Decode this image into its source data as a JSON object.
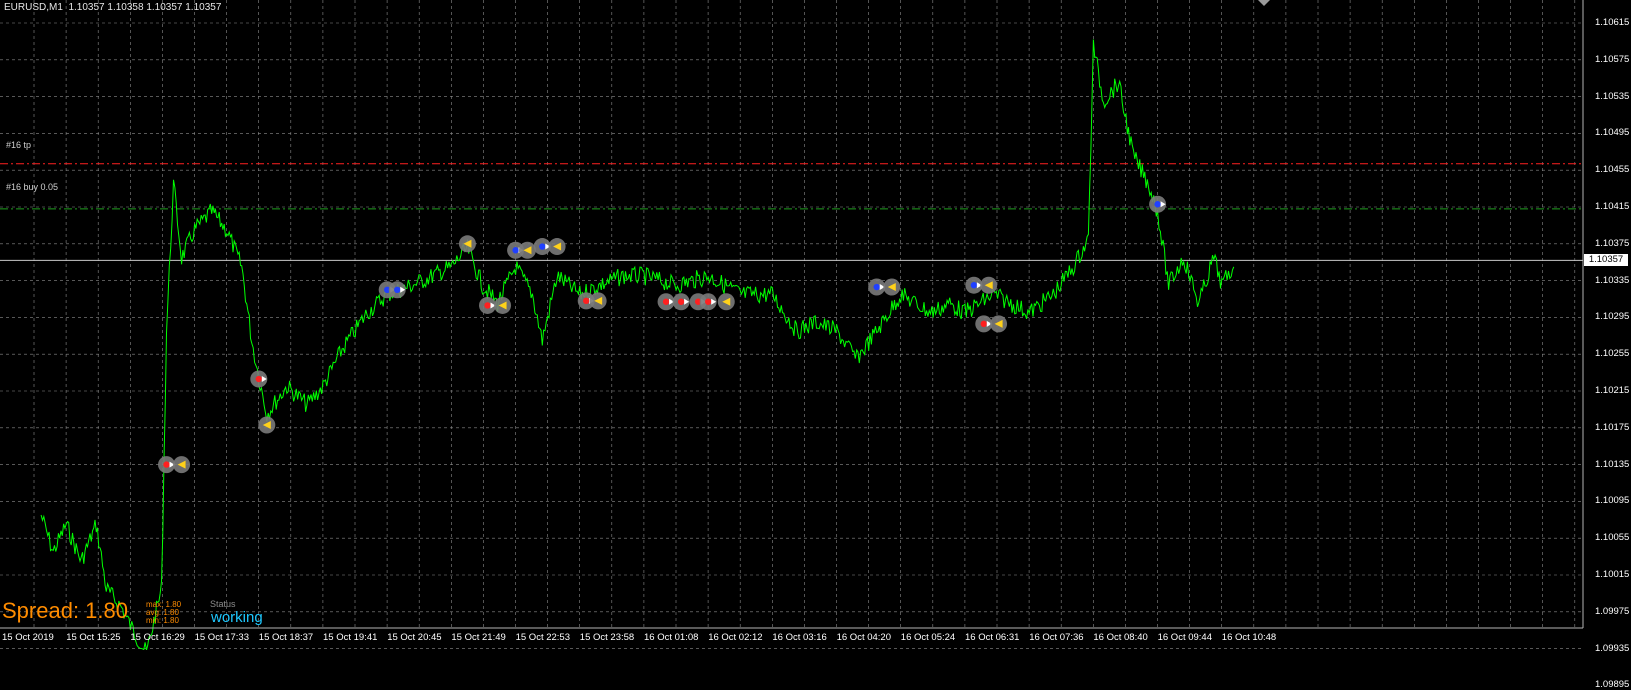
{
  "header": {
    "symbol": "EURUSD,M1",
    "quotes": "1.10357 1.10358 1.10357 1.10357"
  },
  "levels": {
    "tp_label": "#16 tp",
    "buy_label": "#16 buy 0.05",
    "current_price": "1.10357"
  },
  "price_axis": [
    "1.10615",
    "1.10575",
    "1.10535",
    "1.10495",
    "1.10455",
    "1.10415",
    "1.10375",
    "1.10335",
    "1.10295",
    "1.10255",
    "1.10215",
    "1.10175",
    "1.10135",
    "1.10095",
    "1.10055",
    "1.10015",
    "1.09975",
    "1.09935",
    "1.09895"
  ],
  "time_axis": [
    "15 Oct 2019",
    "15 Oct 15:25",
    "15 Oct 16:29",
    "15 Oct 17:33",
    "15 Oct 18:37",
    "15 Oct 19:41",
    "15 Oct 20:45",
    "15 Oct 21:49",
    "15 Oct 22:53",
    "15 Oct 23:58",
    "16 Oct 01:08",
    "16 Oct 02:12",
    "16 Oct 03:16",
    "16 Oct 04:20",
    "16 Oct 05:24",
    "16 Oct 06:31",
    "16 Oct 07:36",
    "16 Oct 08:40",
    "16 Oct 09:44",
    "16 Oct 10:48"
  ],
  "spread_panel": {
    "spread_text": "Spread: 1.80",
    "max_text": "max: 1.80",
    "avg_text": "avg: 1.80",
    "min_text": "min: 1.80",
    "status_label": "Status",
    "status_value": "working"
  },
  "colors": {
    "background": "#000000",
    "grid": "#8c8c8c",
    "price_line": "#00ff00",
    "tp_line": "#ff2020",
    "buy_line": "#1fa01f",
    "spread_text": "#ff8c00",
    "status_value": "#1ec8ff"
  },
  "chart_data": {
    "type": "line",
    "series": [
      {
        "points": [
          [
            "15 Oct 15:00",
            1.1008
          ],
          [
            "15 Oct 15:12",
            1.1004
          ],
          [
            "15 Oct 15:25",
            1.1007
          ],
          [
            "15 Oct 15:40",
            1.1003
          ],
          [
            "15 Oct 15:55",
            1.1007
          ],
          [
            "15 Oct 16:05",
            1.1
          ],
          [
            "15 Oct 16:20",
            1.0998
          ],
          [
            "15 Oct 16:29",
            1.0996
          ],
          [
            "15 Oct 16:45",
            1.0993
          ],
          [
            "15 Oct 17:00",
            1.1
          ],
          [
            "15 Oct 17:05",
            1.1028
          ],
          [
            "15 Oct 17:12",
            1.1044
          ],
          [
            "15 Oct 17:20",
            1.1036
          ],
          [
            "15 Oct 17:33",
            1.1039
          ],
          [
            "15 Oct 17:50",
            1.1041
          ],
          [
            "15 Oct 18:05",
            1.1039
          ],
          [
            "15 Oct 18:20",
            1.1035
          ],
          [
            "15 Oct 18:30",
            1.1027
          ],
          [
            "15 Oct 18:37",
            1.1023
          ],
          [
            "15 Oct 18:45",
            1.1019
          ],
          [
            "15 Oct 19:05",
            1.1022
          ],
          [
            "15 Oct 19:25",
            1.102
          ],
          [
            "15 Oct 19:41",
            1.1022
          ],
          [
            "15 Oct 20:00",
            1.1026
          ],
          [
            "15 Oct 20:25",
            1.103
          ],
          [
            "15 Oct 20:45",
            1.1032
          ],
          [
            "15 Oct 21:10",
            1.1033
          ],
          [
            "15 Oct 21:30",
            1.1034
          ],
          [
            "15 Oct 21:49",
            1.1035
          ],
          [
            "15 Oct 22:05",
            1.1037
          ],
          [
            "15 Oct 22:20",
            1.1033
          ],
          [
            "15 Oct 22:35",
            1.1031
          ],
          [
            "15 Oct 22:53",
            1.1035
          ],
          [
            "15 Oct 23:10",
            1.1032
          ],
          [
            "15 Oct 23:20",
            1.1027
          ],
          [
            "15 Oct 23:35",
            1.1034
          ],
          [
            "15 Oct 23:58",
            1.1032
          ],
          [
            "16 Oct 00:20",
            1.1033
          ],
          [
            "16 Oct 00:45",
            1.1034
          ],
          [
            "16 Oct 01:08",
            1.1034
          ],
          [
            "16 Oct 01:40",
            1.1033
          ],
          [
            "16 Oct 02:12",
            1.1034
          ],
          [
            "16 Oct 02:45",
            1.1032
          ],
          [
            "16 Oct 03:16",
            1.1032
          ],
          [
            "16 Oct 03:40",
            1.1028
          ],
          [
            "16 Oct 04:00",
            1.1029
          ],
          [
            "16 Oct 04:20",
            1.1028
          ],
          [
            "16 Oct 04:40",
            1.1025
          ],
          [
            "16 Oct 05:00",
            1.1028
          ],
          [
            "16 Oct 05:24",
            1.1032
          ],
          [
            "16 Oct 05:55",
            1.103
          ],
          [
            "16 Oct 06:15",
            1.1031
          ],
          [
            "16 Oct 06:31",
            1.103
          ],
          [
            "16 Oct 07:00",
            1.1032
          ],
          [
            "16 Oct 07:36",
            1.103
          ],
          [
            "16 Oct 08:00",
            1.1032
          ],
          [
            "16 Oct 08:20",
            1.1035
          ],
          [
            "16 Oct 08:35",
            1.1038
          ],
          [
            "16 Oct 08:40",
            1.1059
          ],
          [
            "16 Oct 08:50",
            1.1053
          ],
          [
            "16 Oct 09:05",
            1.1055
          ],
          [
            "16 Oct 09:20",
            1.1047
          ],
          [
            "16 Oct 09:35",
            1.1044
          ],
          [
            "16 Oct 09:44",
            1.1041
          ],
          [
            "16 Oct 09:55",
            1.1033
          ],
          [
            "16 Oct 10:10",
            1.1036
          ],
          [
            "16 Oct 10:25",
            1.1031
          ],
          [
            "16 Oct 10:40",
            1.1036
          ],
          [
            "16 Oct 10:48",
            1.1033
          ],
          [
            "16 Oct 11:00",
            1.1035
          ]
        ]
      }
    ],
    "ylim": [
      1.09875,
      1.10635
    ],
    "horizontal_levels": [
      {
        "label": "#16 tp",
        "value": 1.10462,
        "color": "#ff2020",
        "style": "dash-dot"
      },
      {
        "label": "#16 buy 0.05",
        "value": 1.10413,
        "color": "#1fa01f",
        "style": "dash-dot"
      },
      {
        "label": "bid",
        "value": 1.10357,
        "color": "#c8c8c8",
        "style": "solid"
      }
    ],
    "trade_markers": [
      {
        "time": "15 Oct 17:05",
        "price": 1.10135,
        "kind": "entry-sell"
      },
      {
        "time": "15 Oct 17:20",
        "price": 1.10135,
        "kind": "exit"
      },
      {
        "time": "15 Oct 18:37",
        "price": 1.10228,
        "kind": "entry-sell"
      },
      {
        "time": "15 Oct 18:45",
        "price": 1.10178,
        "kind": "exit"
      },
      {
        "time": "15 Oct 20:45",
        "price": 1.10325,
        "kind": "entry-buy"
      },
      {
        "time": "15 Oct 20:55",
        "price": 1.10325,
        "kind": "entry-buy"
      },
      {
        "time": "15 Oct 22:05",
        "price": 1.10375,
        "kind": "exit"
      },
      {
        "time": "15 Oct 22:25",
        "price": 1.10308,
        "kind": "entry-sell"
      },
      {
        "time": "15 Oct 22:40",
        "price": 1.10308,
        "kind": "exit"
      },
      {
        "time": "15 Oct 22:53",
        "price": 1.10368,
        "kind": "entry-buy"
      },
      {
        "time": "15 Oct 23:05",
        "price": 1.10368,
        "kind": "exit"
      },
      {
        "time": "15 Oct 23:20",
        "price": 1.10372,
        "kind": "entry-buy"
      },
      {
        "time": "15 Oct 23:35",
        "price": 1.10372,
        "kind": "exit"
      },
      {
        "time": "16 Oct 00:05",
        "price": 1.10313,
        "kind": "entry-sell"
      },
      {
        "time": "16 Oct 00:18",
        "price": 1.10313,
        "kind": "exit"
      },
      {
        "time": "16 Oct 01:30",
        "price": 1.10312,
        "kind": "entry-sell"
      },
      {
        "time": "16 Oct 01:45",
        "price": 1.10312,
        "kind": "entry-sell"
      },
      {
        "time": "16 Oct 02:02",
        "price": 1.10312,
        "kind": "entry-sell"
      },
      {
        "time": "16 Oct 02:12",
        "price": 1.10312,
        "kind": "entry-sell"
      },
      {
        "time": "16 Oct 02:30",
        "price": 1.10312,
        "kind": "exit"
      },
      {
        "time": "16 Oct 05:00",
        "price": 1.10328,
        "kind": "entry-buy"
      },
      {
        "time": "16 Oct 05:15",
        "price": 1.10328,
        "kind": "exit"
      },
      {
        "time": "16 Oct 06:40",
        "price": 1.1033,
        "kind": "entry-buy"
      },
      {
        "time": "16 Oct 06:55",
        "price": 1.1033,
        "kind": "exit"
      },
      {
        "time": "16 Oct 06:50",
        "price": 1.10288,
        "kind": "entry-sell"
      },
      {
        "time": "16 Oct 07:05",
        "price": 1.10288,
        "kind": "exit"
      },
      {
        "time": "16 Oct 09:44",
        "price": 1.10418,
        "kind": "entry-buy"
      }
    ]
  }
}
